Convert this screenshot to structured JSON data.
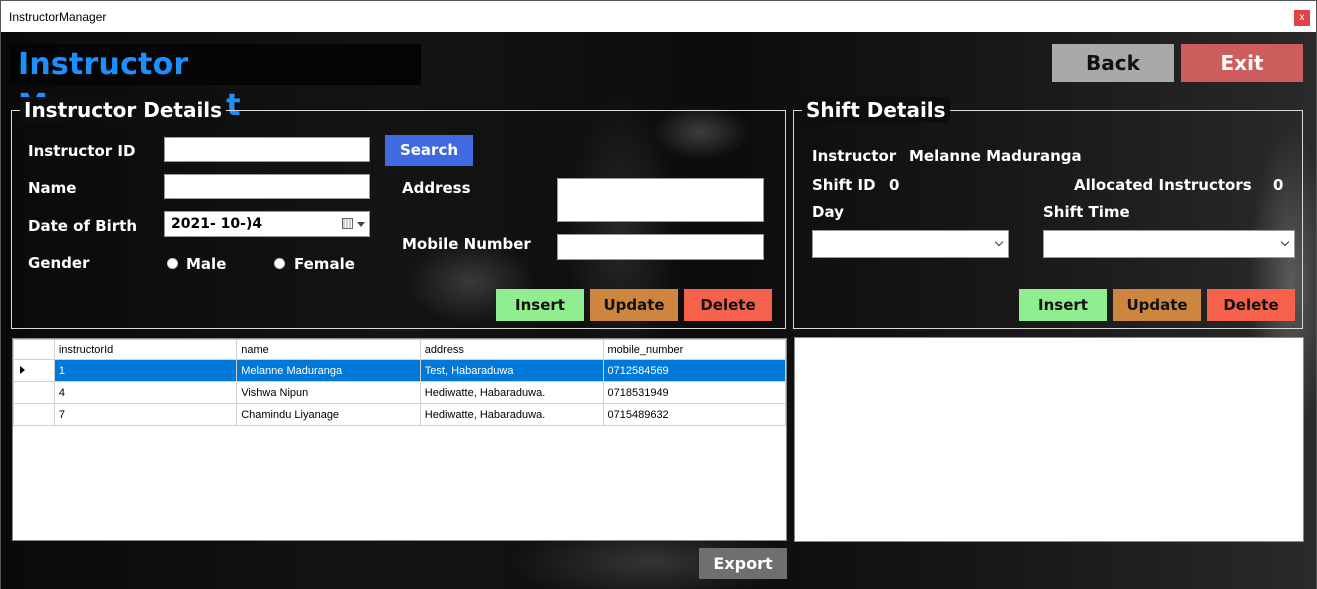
{
  "window": {
    "title": "InstructorManager",
    "close_label": "x"
  },
  "header": {
    "title": "Instructor Management",
    "back_label": "Back",
    "exit_label": "Exit"
  },
  "instructor_details": {
    "title": "Instructor Details",
    "id_label": "Instructor ID",
    "id_value": "",
    "search_label": "Search",
    "name_label": "Name",
    "name_value": "",
    "dob_label": "Date of Birth",
    "dob_value": "2021- 10-)4",
    "gender_label": "Gender",
    "gender_male": "Male",
    "gender_female": "Female",
    "address_label": "Address",
    "address_value": "",
    "mobile_label": "Mobile Number",
    "mobile_value": "",
    "insert_label": "Insert",
    "update_label": "Update",
    "delete_label": "Delete"
  },
  "shift_details": {
    "title": "Shift Details",
    "instructor_label": "Instructor",
    "instructor_value": "Melanne Maduranga",
    "shift_id_label": "Shift ID",
    "shift_id_value": "0",
    "allocated_label": "Allocated Instructors",
    "allocated_value": "0",
    "day_label": "Day",
    "day_value": "",
    "shift_time_label": "Shift Time",
    "shift_time_value": "",
    "insert_label": "Insert",
    "update_label": "Update",
    "delete_label": "Delete"
  },
  "grid": {
    "columns": [
      "instructorId",
      "name",
      "address",
      "mobile_number"
    ],
    "rows": [
      [
        "1",
        "Melanne Maduranga",
        "Test, Habaraduwa",
        "0712584569"
      ],
      [
        "4",
        "Vishwa Nipun",
        "Hediwatte, Habaraduwa.",
        "0718531949"
      ],
      [
        "7",
        "Chamindu Liyanage",
        "Hediwatte, Habaraduwa.",
        "0715489632"
      ]
    ]
  },
  "export_label": "Export",
  "colors": {
    "title_blue": "#1e8fff",
    "search_blue": "#4169e1",
    "insert_green": "#90ee90",
    "update_orange": "#cd853f",
    "delete_red": "#f5614a",
    "exit_red": "#cd5c5c",
    "back_gray": "#a9a9a9",
    "selection_blue": "#0078d7"
  }
}
